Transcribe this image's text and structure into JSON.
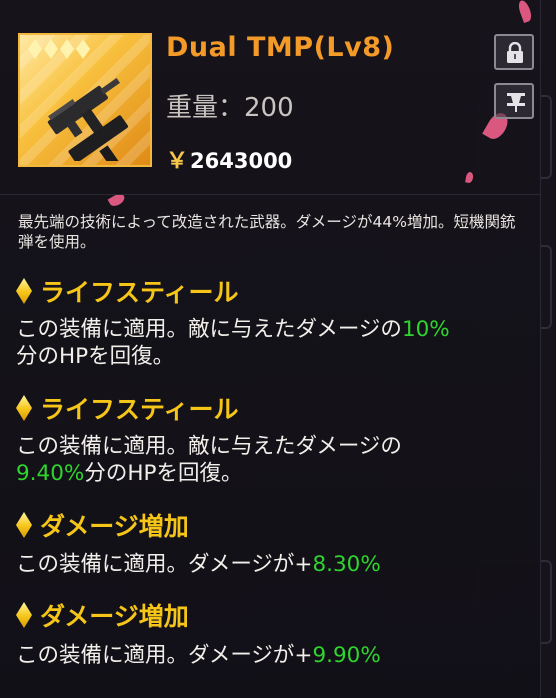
{
  "item": {
    "name": "Dual TMP(Lv8)",
    "weight_text": "重量：200",
    "currency_symbol": "￥",
    "price": "2643000",
    "rarity_stars": 4,
    "description": "最先端の技術によって改造された武器。ダメージが44%増加。短機関銃弾を使用。",
    "card_colors": {
      "border": "#f3b93c",
      "fill": "#f8c13e"
    },
    "icon": "dual-tmp-weapon-icon"
  },
  "buttons": {
    "lock_icon": "lock-icon",
    "pin_icon": "pin-icon"
  },
  "skills": [
    {
      "title": "ライフスティール",
      "desc_pre": "この装備に適用。敵に与えたダメージの",
      "value": "10%",
      "desc_post": "分のHPを回復。"
    },
    {
      "title": "ライフスティール",
      "desc_pre": "この装備に適用。敵に与えたダメージの",
      "value": "9.40%",
      "desc_post": "分のHPを回復。"
    },
    {
      "title": "ダメージ増加",
      "desc_pre": "この装備に適用。ダメージが+",
      "value": "8.30%",
      "desc_post": ""
    },
    {
      "title": "ダメージ増加",
      "desc_pre": "この装備に適用。ダメージが+",
      "value": "9.90%",
      "desc_post": ""
    }
  ],
  "colors": {
    "name": "#f39a28",
    "skill_title": "#f5c518",
    "highlight": "#2fd42f",
    "background": "#16131c"
  }
}
